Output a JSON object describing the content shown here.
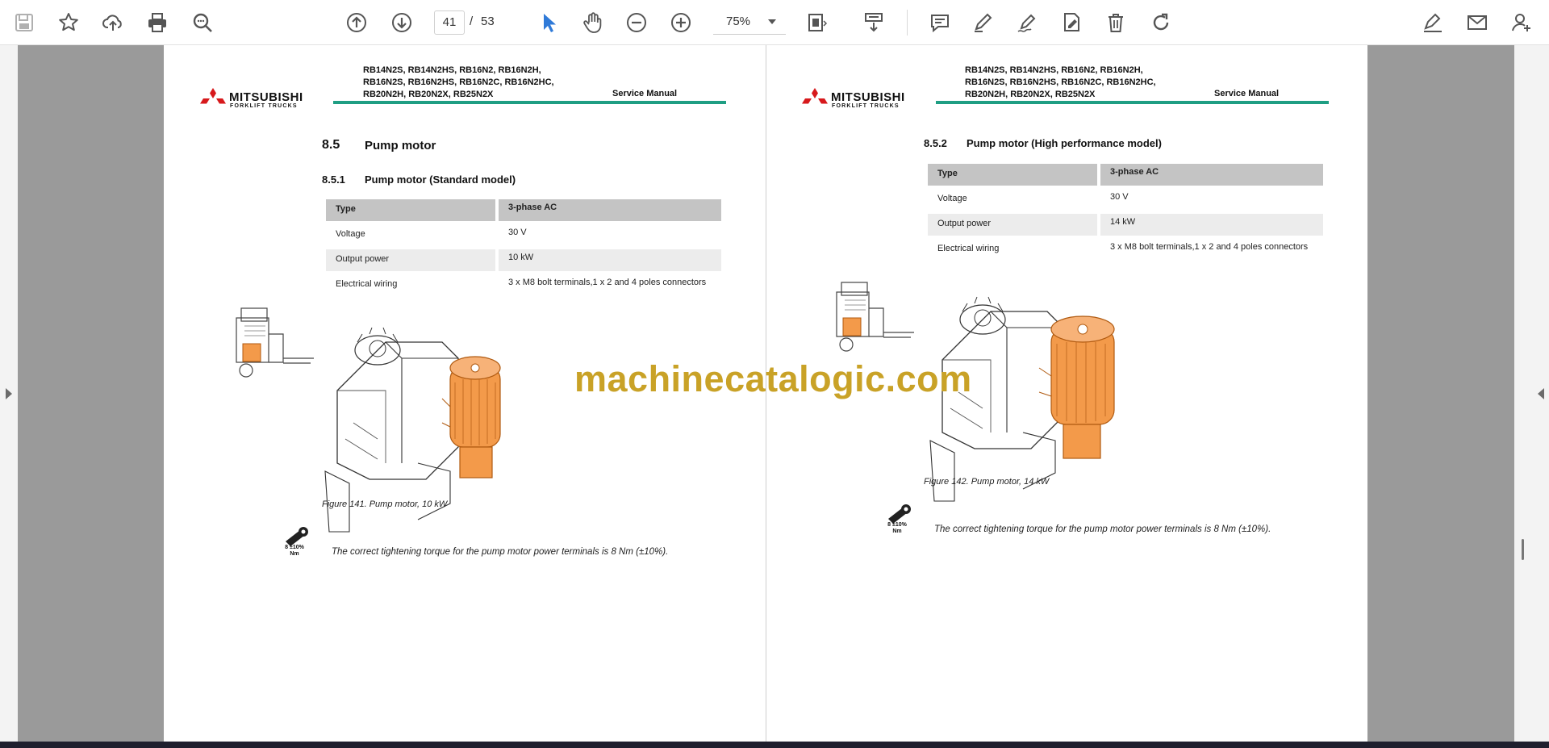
{
  "toolbar": {
    "icons": [
      "save-icon",
      "bookmark-star-icon",
      "upload-cloud-icon",
      "print-icon",
      "zoom-search-icon",
      "page-up-icon",
      "page-down-icon",
      "select-arrow-icon",
      "hand-pan-icon",
      "zoom-out-icon",
      "zoom-in-icon",
      "fit-page-icon",
      "scroll-mode-icon",
      "comment-icon",
      "highlight-pen-icon",
      "sign-pen-icon",
      "edit-export-icon",
      "trash-icon",
      "rotate-icon",
      "fill-sign-icon",
      "email-icon",
      "account-icon"
    ],
    "current_page": "41",
    "page_separator": "/",
    "total_pages": "53",
    "zoom": "75%",
    "accent_color": "#2f7ad8"
  },
  "doc": {
    "logo_word": "MITSUBISHI",
    "logo_sub": "FORKLIFT TRUCKS",
    "brand_color": "#d7191c",
    "header_color": "#1f9e83",
    "models_line1": "RB14N2S, RB14N2HS, RB16N2, RB16N2H,",
    "models_line2_left": "RB16N2S, RB16N2HS, RB16N2C, RB16N2HC,",
    "models_line2_right": "RB16N2S, RB16N2HS, RB16N2C, RB16N2HC,",
    "models_line3": "RB20N2H, RB20N2X, RB25N2X",
    "manual": "Service Manual"
  },
  "left_page": {
    "section_num": "8.5",
    "section_title": "Pump motor",
    "subsection_num": "8.5.1",
    "subsection_title": "Pump motor (Standard model)",
    "table": [
      {
        "k": "Type",
        "v": "3-phase AC"
      },
      {
        "k": "Voltage",
        "v": "30 V"
      },
      {
        "k": "Output power",
        "v": "10 kW"
      },
      {
        "k": "Electrical wiring",
        "v": "3 x M8 bolt terminals,1 x 2 and 4 poles connectors"
      }
    ],
    "caption": "Figure 141. Pump motor, 10 kW",
    "torque_label_1": "8 ±10%",
    "torque_label_2": "Nm",
    "note": "The correct tightening torque for the pump motor power terminals is 8 Nm (±10%)."
  },
  "right_page": {
    "subsection_num": "8.5.2",
    "subsection_title": "Pump motor (High performance model)",
    "table": [
      {
        "k": "Type",
        "v": "3-phase AC"
      },
      {
        "k": "Voltage",
        "v": "30 V"
      },
      {
        "k": "Output power",
        "v": "14 kW"
      },
      {
        "k": "Electrical wiring",
        "v": "3 x M8 bolt terminals,1 x 2 and 4 poles connectors"
      }
    ],
    "caption": "Figure 142. Pump motor, 14 kW",
    "torque_label_1": "8 ±10%",
    "torque_label_2": "Nm",
    "note": "The correct tightening torque for the pump motor power terminals is 8 Nm (±10%)."
  },
  "watermark": "machinecatalogic.com"
}
